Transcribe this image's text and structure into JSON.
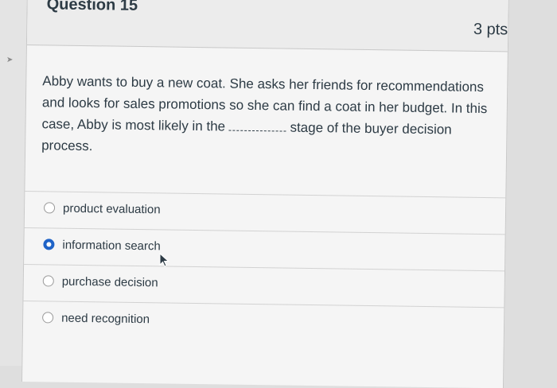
{
  "question": {
    "title": "Question 15",
    "points": "3 pts",
    "text": "Abby wants to buy a new coat. She asks her friends for recommendations and looks for sales promotions so she can find a coat in her budget. In this case, Abby is most likely in the",
    "text_end": "stage of the buyer decision process."
  },
  "answers": [
    {
      "label": "product evaluation",
      "selected": false
    },
    {
      "label": "information search",
      "selected": true
    },
    {
      "label": "purchase decision",
      "selected": false
    },
    {
      "label": "need recognition",
      "selected": false
    }
  ],
  "colors": {
    "accent": "#1f63c7",
    "text": "#2d3b45",
    "card": "#f5f5f5",
    "header": "#ececec"
  }
}
